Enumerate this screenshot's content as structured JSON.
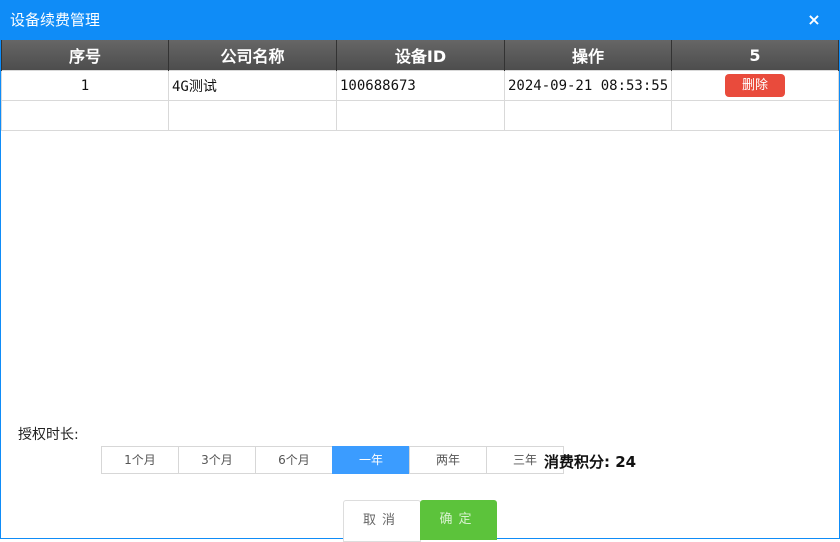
{
  "dialog": {
    "title": "设备续费管理",
    "close_icon": "×"
  },
  "table": {
    "headers": [
      "序号",
      "公司名称",
      "设备ID",
      "操作",
      "5"
    ],
    "rows": [
      {
        "index": "1",
        "company": "4G测试",
        "device_id": "100688673",
        "time": "2024-09-21 08:53:55",
        "delete_label": "删除"
      }
    ]
  },
  "authorization": {
    "label": "授权时长:",
    "options": [
      "1个月",
      "3个月",
      "6个月",
      "一年",
      "两年",
      "三年"
    ],
    "selected": "一年"
  },
  "points": {
    "label": "消费积分:",
    "value": "24"
  },
  "buttons": {
    "cancel": "取消",
    "confirm": "确定"
  },
  "colors": {
    "title_bar": "#0f8cf7",
    "delete": "#e94b3c",
    "selected_option": "#3b9cff",
    "confirm": "#5cc33b"
  }
}
